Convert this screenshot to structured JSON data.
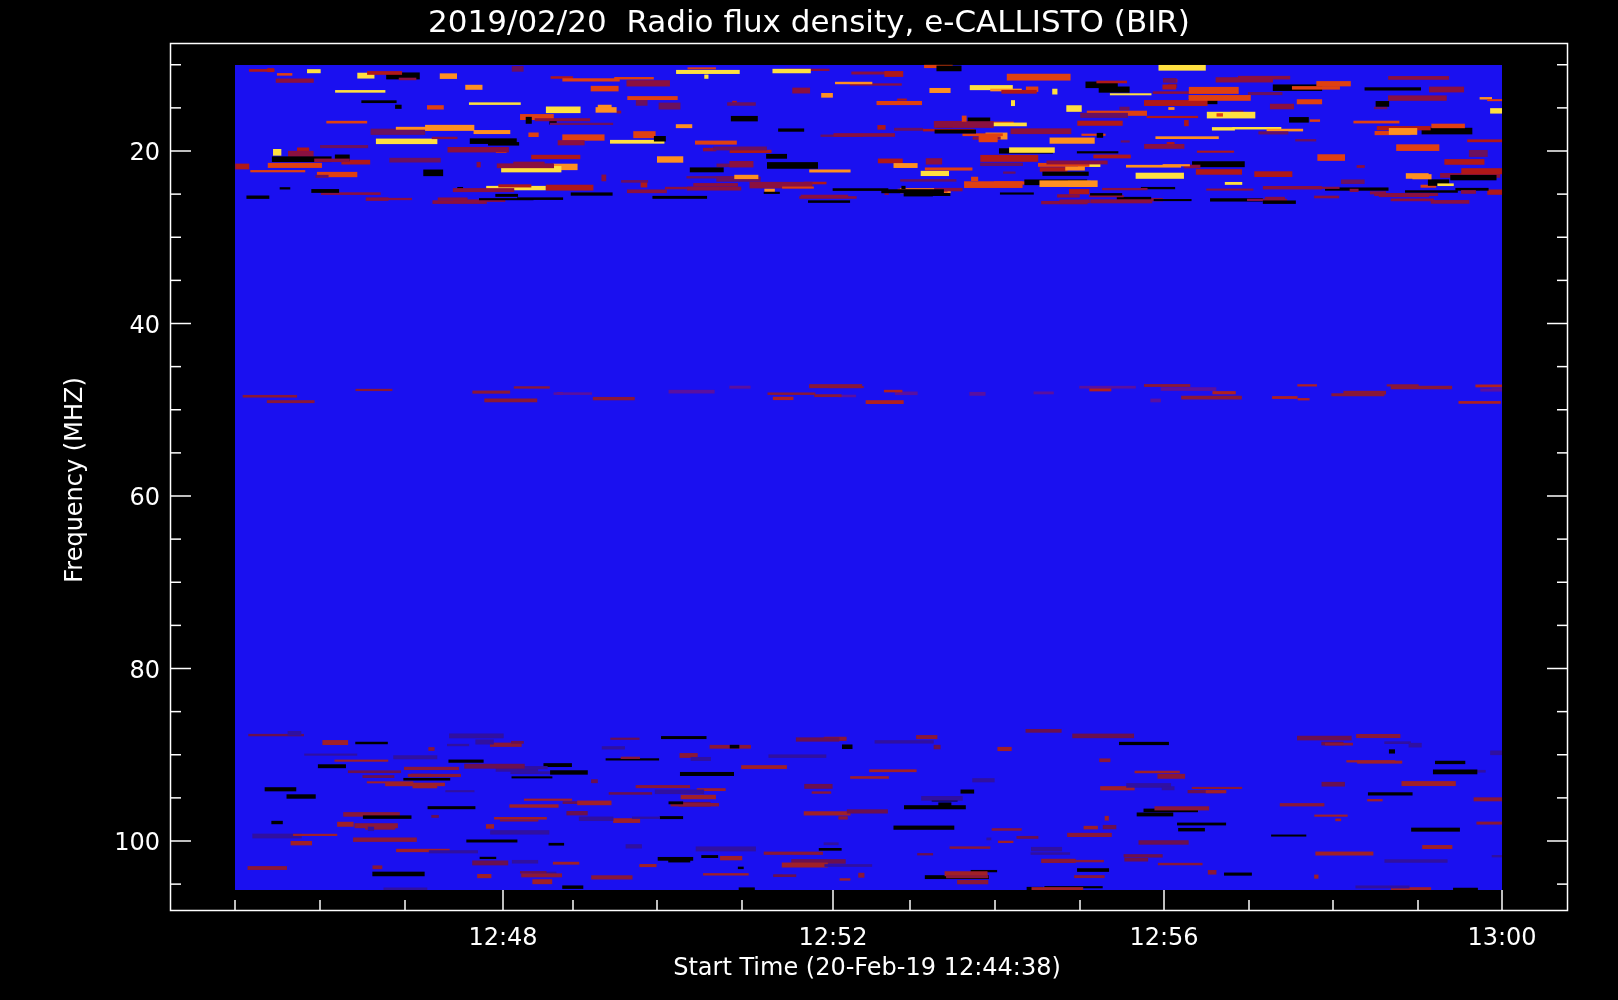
{
  "chart": {
    "title": "2019/02/20  Radio flux density, e-CALLISTO (BIR)",
    "ylabel": "Frequency (MHZ)",
    "xlabel": "Start Time (20-Feb-19 12:44:38)",
    "yticks": [
      "20",
      "40",
      "60",
      "80",
      "100"
    ],
    "xticks": [
      "12:48",
      "12:52",
      "12:56",
      "13:00"
    ]
  }
}
